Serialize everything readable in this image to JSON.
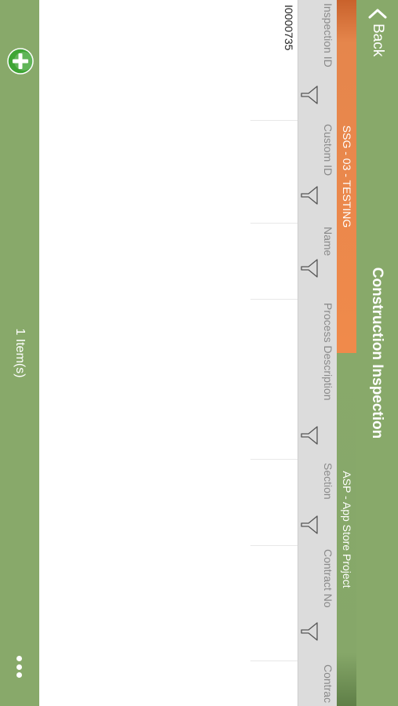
{
  "navbar": {
    "back_label": "Back",
    "title": "Construction Inspection"
  },
  "tabs": [
    {
      "label": "SSG - 03 - TESTING",
      "active": true
    },
    {
      "label": "ASP - App Store Project",
      "active": false
    }
  ],
  "grid": {
    "columns": [
      {
        "label": "Inspection ID"
      },
      {
        "label": "Custom ID"
      },
      {
        "label": "Name"
      },
      {
        "label": "Process Description"
      },
      {
        "label": "Section"
      },
      {
        "label": "Contract No"
      },
      {
        "label": "Contrac"
      }
    ],
    "rows": [
      [
        "I0000735",
        "",
        "",
        "",
        "",
        "",
        ""
      ]
    ]
  },
  "footer": {
    "item_count": "1 Item(s)",
    "add_icon": "plus-circle-icon",
    "more_icon": "more-dots-icon"
  },
  "colors": {
    "bar_green": "#88a96a",
    "tab_orange": "#f08a4b",
    "header_gray": "#dcdcdc",
    "add_green": "#3fa535"
  }
}
